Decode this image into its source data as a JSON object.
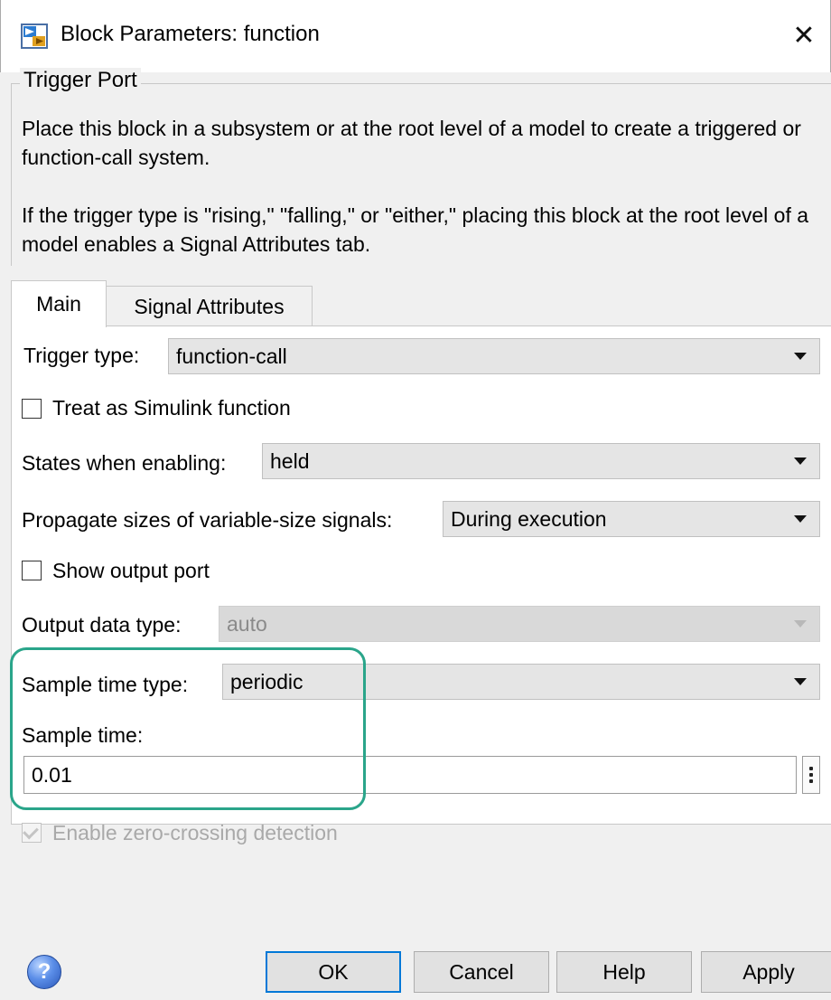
{
  "window": {
    "title": "Block Parameters: function",
    "close_glyph": "✕"
  },
  "group": {
    "title": "Trigger Port",
    "description_1": "Place this block in a subsystem or at the root level of a model to create a triggered or function-call system.",
    "description_2": "If the trigger type is \"rising,\" \"falling,\" or \"either,\" placing this block at the root level of a model enables a Signal Attributes tab."
  },
  "tabs": [
    {
      "label": "Main",
      "selected": true
    },
    {
      "label": "Signal Attributes",
      "selected": false
    }
  ],
  "main": {
    "trigger_type": {
      "label": "Trigger type:",
      "value": "function-call"
    },
    "treat_simulink": {
      "label": "Treat as Simulink function",
      "checked": false
    },
    "states_enabling": {
      "label": "States when enabling:",
      "value": "held"
    },
    "propagate_sizes": {
      "label": "Propagate sizes of variable-size signals:",
      "value": "During execution"
    },
    "show_output": {
      "label": "Show output port",
      "checked": false
    },
    "output_data_type": {
      "label": "Output data type:",
      "value": "auto",
      "disabled": true
    },
    "sample_time_type": {
      "label": "Sample time type:",
      "value": "periodic"
    },
    "sample_time": {
      "label": "Sample time:",
      "value": "0.01"
    },
    "zero_crossing": {
      "label": "Enable zero-crossing detection",
      "checked": true,
      "disabled": true
    }
  },
  "footer": {
    "help_icon_glyph": "?",
    "ok": "OK",
    "cancel": "Cancel",
    "help": "Help",
    "apply": "Apply"
  },
  "colors": {
    "highlight": "#2aa58a",
    "ok_border": "#0078d7"
  }
}
